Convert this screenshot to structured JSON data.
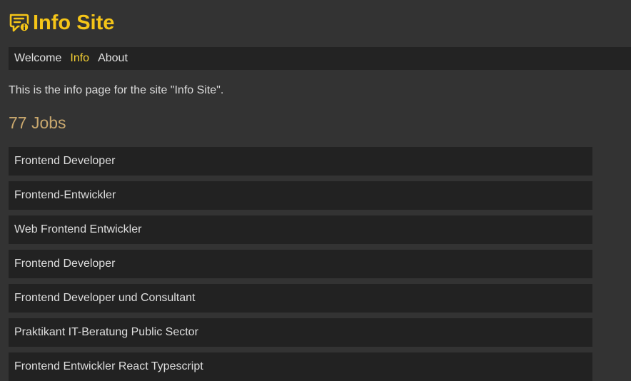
{
  "header": {
    "title": "Info Site",
    "icon": "message-info-icon",
    "accent_color": "#f5c518"
  },
  "nav": {
    "items": [
      {
        "label": "Welcome",
        "active": false
      },
      {
        "label": "Info",
        "active": true
      },
      {
        "label": "About",
        "active": false
      }
    ],
    "active_color": "#f5d033"
  },
  "main": {
    "intro": "This is the info page for the site \"Info Site\".",
    "jobs_heading": "77 Jobs",
    "jobs": [
      "Frontend Developer",
      "Frontend-Entwickler",
      "Web Frontend Entwickler",
      "Frontend Developer",
      "Frontend Developer und Consultant",
      "Praktikant IT-Beratung Public Sector",
      "Frontend Entwickler React Typescript"
    ]
  }
}
